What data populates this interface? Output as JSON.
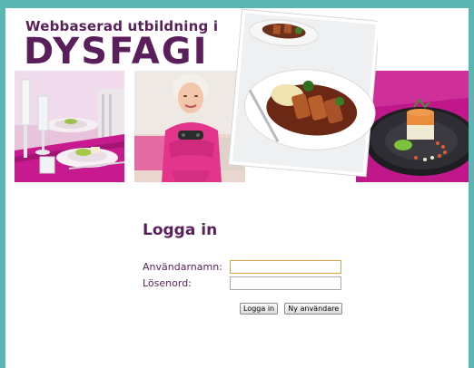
{
  "header": {
    "subtitle": "Webbaserad utbildning i",
    "title": "DYSFAGI"
  },
  "login": {
    "heading": "Logga in",
    "username_label": "Användarnamn:",
    "username_value": "",
    "password_label": "Lösenord:",
    "password_value": "",
    "login_button": "Logga in",
    "new_user_button": "Ny användare"
  },
  "colors": {
    "frame": "#5bb7b2",
    "brand": "#5a1f5a",
    "accent_pink": "#c0188a"
  },
  "images": [
    "table-setting-photo",
    "elderly-woman-gaming-photo",
    "sliced-meat-dish-photo",
    "plated-timbale-photo"
  ]
}
